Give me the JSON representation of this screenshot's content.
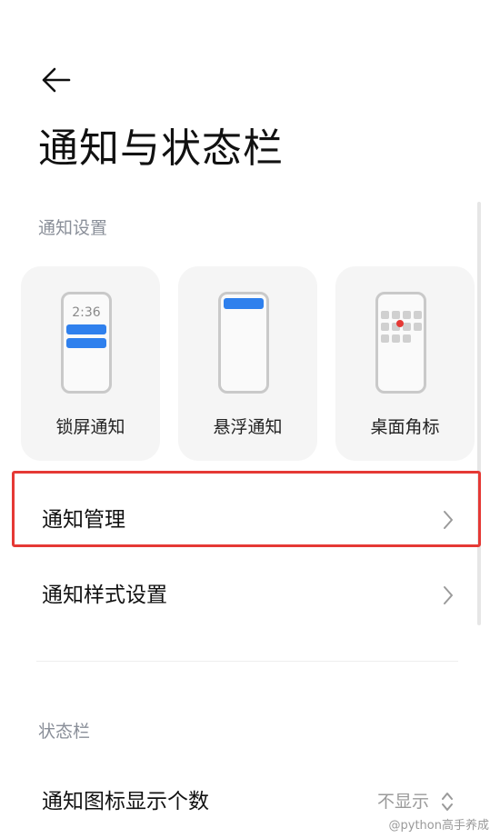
{
  "header": {
    "back_icon": "arrow-left-icon",
    "title": "通知与状态栏"
  },
  "notification_settings": {
    "section_label": "通知设置",
    "cards": [
      {
        "label": "锁屏通知",
        "icon": "lock-screen-preview-icon",
        "clock": "2:36"
      },
      {
        "label": "悬浮通知",
        "icon": "floating-preview-icon"
      },
      {
        "label": "桌面角标",
        "icon": "desktop-badge-preview-icon"
      }
    ],
    "rows": [
      {
        "label": "通知管理",
        "icon": "chevron-right-icon",
        "highlighted": true
      },
      {
        "label": "通知样式设置",
        "icon": "chevron-right-icon"
      }
    ]
  },
  "status_bar": {
    "section_label": "状态栏",
    "rows": [
      {
        "label": "通知图标显示个数",
        "value": "不显示",
        "icon": "stepper-up-down-icon"
      }
    ]
  },
  "watermark": "@python高手养成",
  "colors": {
    "accent_blue": "#2f80ed",
    "highlight_red": "#e53935",
    "badge_red": "#e53935"
  }
}
